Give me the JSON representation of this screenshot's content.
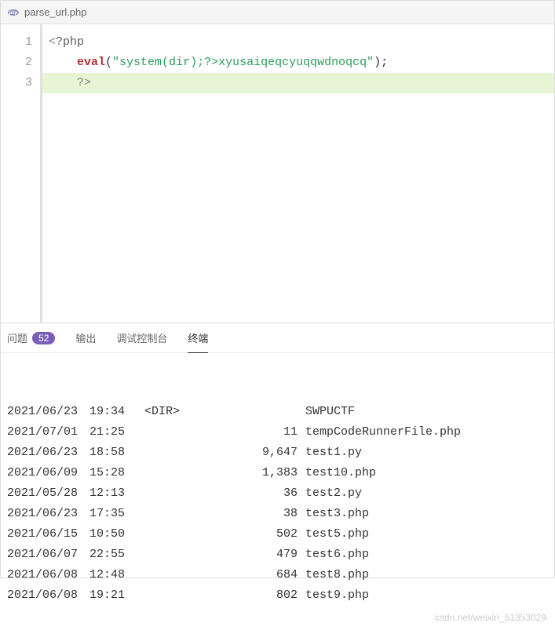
{
  "tab": {
    "filename": "parse_url.php"
  },
  "code": {
    "lines": [
      "1",
      "2",
      "3"
    ],
    "line1": {
      "open": "<",
      "php": "?php"
    },
    "line2": {
      "indent": "    ",
      "func": "eval",
      "lparen": "(",
      "string": "\"system(dir);?>xyusaiqeqcyuqqwdnoqcq\"",
      "rparen": ")",
      "semi": ";"
    },
    "line3": {
      "indent": "    ",
      "close1": "?",
      "close2": ">"
    }
  },
  "panel": {
    "tabs": {
      "problems": "问题",
      "problems_count": "52",
      "output": "输出",
      "debug": "调试控制台",
      "terminal": "终端"
    }
  },
  "terminal": {
    "rows": [
      {
        "date": "2021/06/23",
        "time": "19:34",
        "type": "<DIR>",
        "size": "",
        "name": "SWPUCTF"
      },
      {
        "date": "2021/07/01",
        "time": "21:25",
        "type": "",
        "size": "11",
        "name": "tempCodeRunnerFile.php"
      },
      {
        "date": "2021/06/23",
        "time": "18:58",
        "type": "",
        "size": "9,647",
        "name": "test1.py"
      },
      {
        "date": "2021/06/09",
        "time": "15:28",
        "type": "",
        "size": "1,383",
        "name": "test10.php"
      },
      {
        "date": "2021/05/28",
        "time": "12:13",
        "type": "",
        "size": "36",
        "name": "test2.py"
      },
      {
        "date": "2021/06/23",
        "time": "17:35",
        "type": "",
        "size": "38",
        "name": "test3.php"
      },
      {
        "date": "2021/06/15",
        "time": "10:50",
        "type": "",
        "size": "502",
        "name": "test5.php"
      },
      {
        "date": "2021/06/07",
        "time": "22:55",
        "type": "",
        "size": "479",
        "name": "test6.php"
      },
      {
        "date": "2021/06/08",
        "time": "12:48",
        "type": "",
        "size": "684",
        "name": "test8.php"
      },
      {
        "date": "2021/06/08",
        "time": "19:21",
        "type": "",
        "size": "802",
        "name": "test9.php"
      }
    ]
  },
  "watermark": "csdn.net/weixin_51353029"
}
